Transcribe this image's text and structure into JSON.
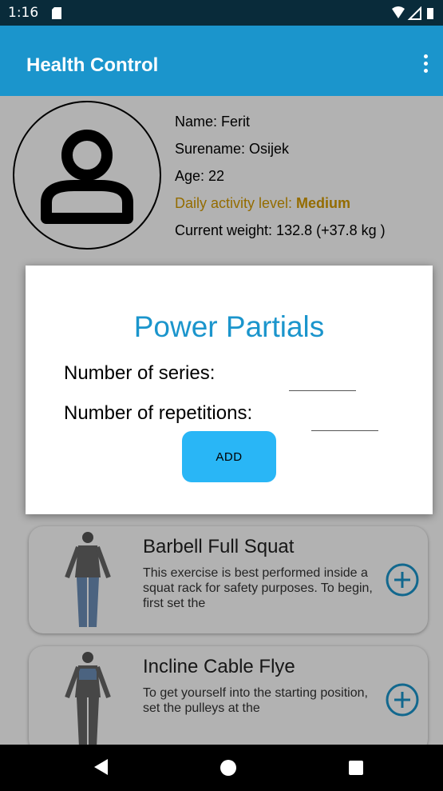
{
  "status_bar": {
    "time": "1:16"
  },
  "app_bar": {
    "title": "Health Control",
    "menu_icon": "more-vert-icon"
  },
  "profile": {
    "name": "Name: Ferit",
    "surname": "Surename: Osijek",
    "age": "Age: 22",
    "activity_label": "Daily activity level: ",
    "activity_value": "Medium",
    "weight": "Current weight: 132.8  (+37.8 kg )"
  },
  "exercises": [
    {
      "title": "Barbell Full Squat",
      "description": "This exercise is best performed inside a squat rack for safety purposes. To begin, first set the"
    },
    {
      "title": "Incline Cable Flye",
      "description": "To get yourself into the starting position, set the pulleys at the"
    }
  ],
  "dialog": {
    "title": "Power Partials",
    "series_label": "Number of series:",
    "series_value": "",
    "repetitions_label": "Number of repetitions:",
    "repetitions_value": "",
    "add_label": "ADD"
  },
  "colors": {
    "primary": "#1b95cc",
    "status_bar": "#092b3a",
    "accent": "#29b6f6",
    "activity": "#d49b00"
  }
}
